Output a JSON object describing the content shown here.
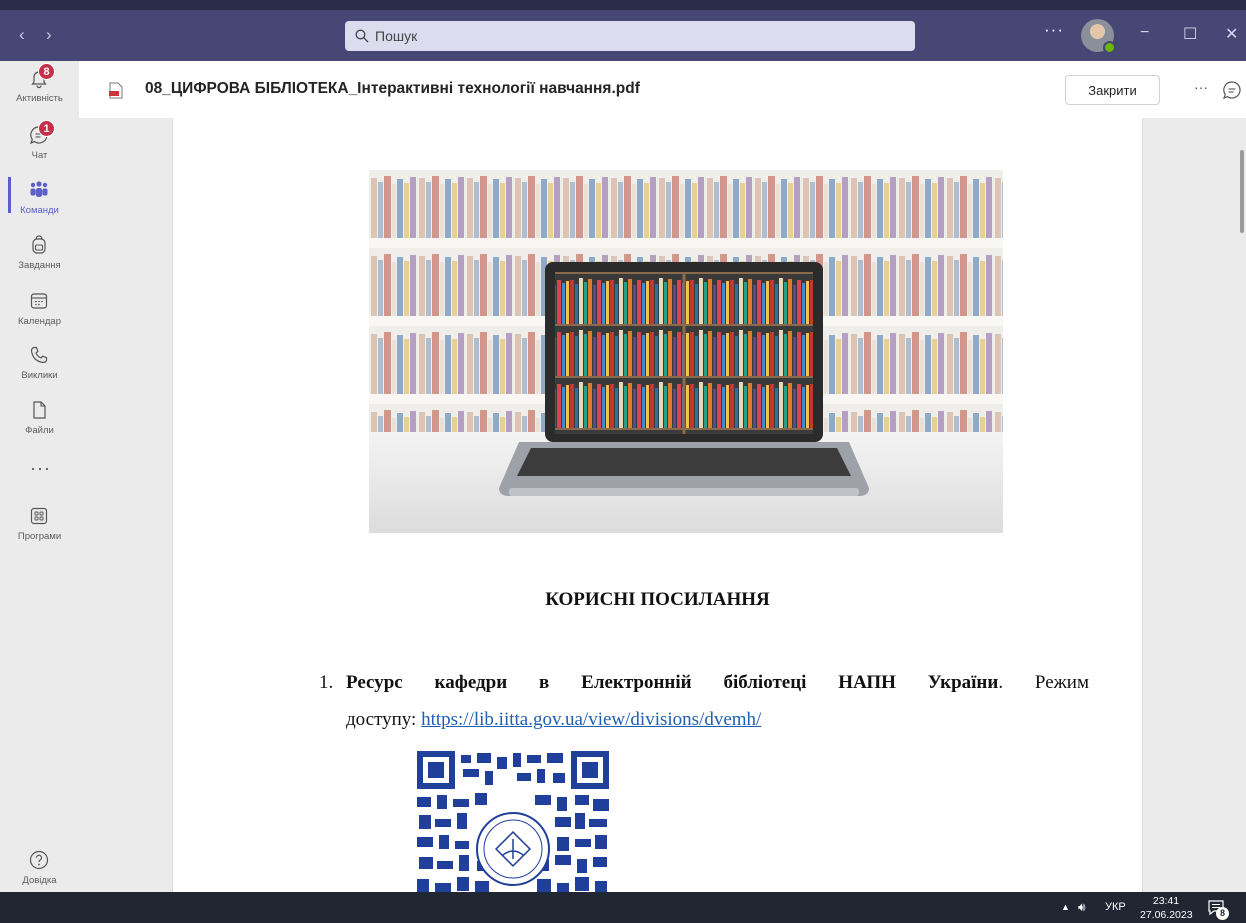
{
  "titlebar": {
    "back_icon": "chevron-left-icon",
    "forward_icon": "chevron-right-icon",
    "search_placeholder": "Пошук",
    "more_label": "···",
    "minimize_label": "−",
    "maximize_label": "☐",
    "close_label": "✕",
    "brand_color": "#464775"
  },
  "rail": {
    "items": [
      {
        "label": "Активність",
        "icon": "bell-icon",
        "badge": "8"
      },
      {
        "label": "Чат",
        "icon": "chat-icon",
        "badge": "1"
      },
      {
        "label": "Команди",
        "icon": "teams-icon",
        "active": true
      },
      {
        "label": "Завдання",
        "icon": "backpack-icon"
      },
      {
        "label": "Календар",
        "icon": "calendar-icon"
      },
      {
        "label": "Виклики",
        "icon": "phone-icon"
      },
      {
        "label": "Файли",
        "icon": "file-icon"
      },
      {
        "label": "Програми",
        "icon": "apps-icon"
      }
    ],
    "more_label": "···",
    "help_label": "Довідка",
    "accent_color": "#5b5fc7",
    "badge_color": "#c4314b"
  },
  "header": {
    "title": "08_ЦИФРОВА БІБЛІОТЕКА_Інтерактивні технології навчання.pdf",
    "close_button": "Закрити",
    "more_label": "···"
  },
  "document": {
    "heading": "КОРИСНІ ПОСИЛАННЯ",
    "item1": {
      "number": "1.",
      "bold_text": "Ресурс кафедри в Електронній бібліотеці НАПН України",
      "text": ". Режим",
      "access_label": "доступу: ",
      "link": "https://lib.iitta.gov.ua/view/divisions/dvemh/"
    },
    "link_color": "#1f5fb3"
  },
  "taskbar": {
    "lang": "УКР",
    "time": "23:41",
    "date": "27.06.2023",
    "notification_count": "8"
  }
}
